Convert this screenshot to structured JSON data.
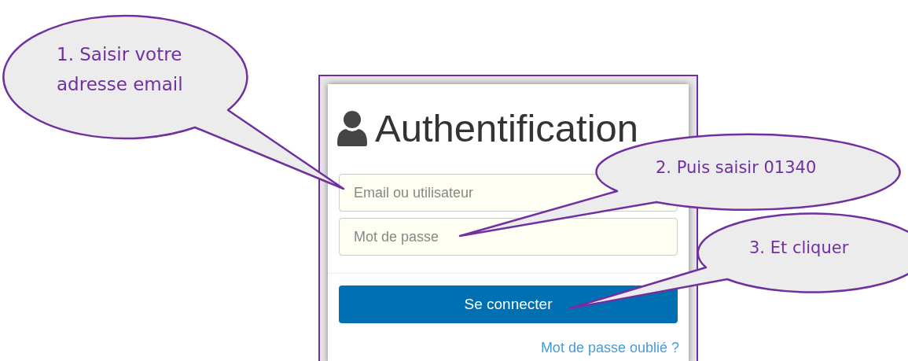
{
  "login_form": {
    "title": "Authentification",
    "email_field": {
      "placeholder": "Email ou utilisateur"
    },
    "password_field": {
      "placeholder": "Mot de passe"
    },
    "submit_button": "Se connecter",
    "forgot_link": "Mot de passe oublié ?"
  },
  "callouts": [
    {
      "text": "1. Saisir votre adresse email"
    },
    {
      "text": "2. Puis saisir 01340"
    },
    {
      "text": "3. Et cliquer"
    }
  ]
}
